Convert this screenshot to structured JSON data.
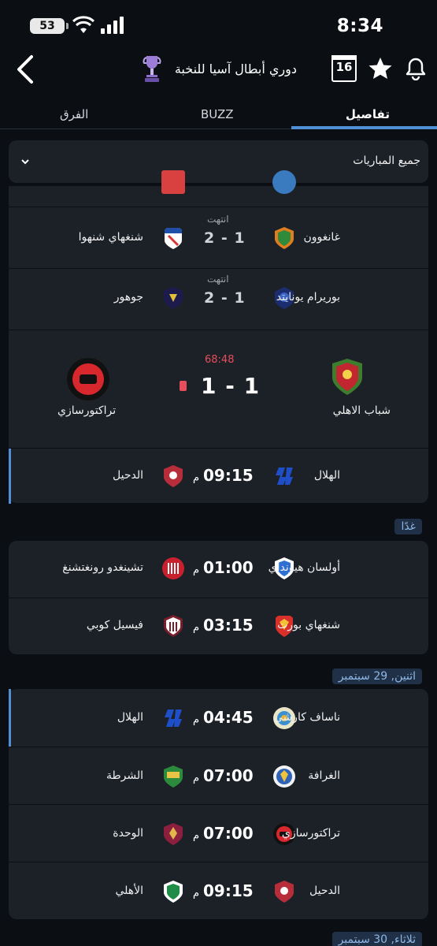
{
  "status_bar": {
    "time": "8:34",
    "battery": "53"
  },
  "header": {
    "title": "دوري أبطال آسيا للنخبة",
    "calendar_day": "16"
  },
  "tabs": [
    {
      "label": "تفاصيل"
    },
    {
      "label": "BUZZ"
    },
    {
      "label": "الفرق"
    }
  ],
  "filter": {
    "label": "جميع المباريات"
  },
  "matches": [
    {
      "home": "غانغوون",
      "away": "شنغهاي شنهوا",
      "score": "2 - 1",
      "status": "انتهت"
    },
    {
      "home": "بوريرام يونايتد",
      "away": "جوهور",
      "score": "2 - 1",
      "status": "انتهت"
    },
    {
      "home": "شباب الاهلي",
      "away": "تراكتورسازي",
      "score": "1 - 1",
      "minute": "68:48"
    },
    {
      "home": "الهلال",
      "away": "الدحيل",
      "time": "09:15",
      "suffix": "م"
    }
  ],
  "sections": [
    {
      "date": "غدًا",
      "matches": [
        {
          "home": "أولسان هيونداي",
          "away": "تشينغدو رونغتشنغ",
          "time": "01:00",
          "suffix": "م"
        },
        {
          "home": "شنغهاي بورت",
          "away": "فيسيل كوبي",
          "time": "03:15",
          "suffix": "م"
        }
      ]
    },
    {
      "date": "اثنين, 29 سبتمبر",
      "matches": [
        {
          "home": "ناساف كارشي",
          "away": "الهلال",
          "time": "04:45",
          "suffix": "م"
        },
        {
          "home": "الغرافة",
          "away": "الشرطة",
          "time": "07:00",
          "suffix": "م"
        },
        {
          "home": "تراكتورسازي",
          "away": "الوحدة",
          "time": "07:00",
          "suffix": "م"
        },
        {
          "home": "الدحيل",
          "away": "الأهلي",
          "time": "09:15",
          "suffix": "م"
        }
      ]
    },
    {
      "date": "ثلاثاء, 30 سبتمبر"
    }
  ],
  "colors": {
    "accent": "#4f8fd6",
    "card": "#1c2128",
    "background": "#0b0f14",
    "live": "#e84d5b"
  }
}
